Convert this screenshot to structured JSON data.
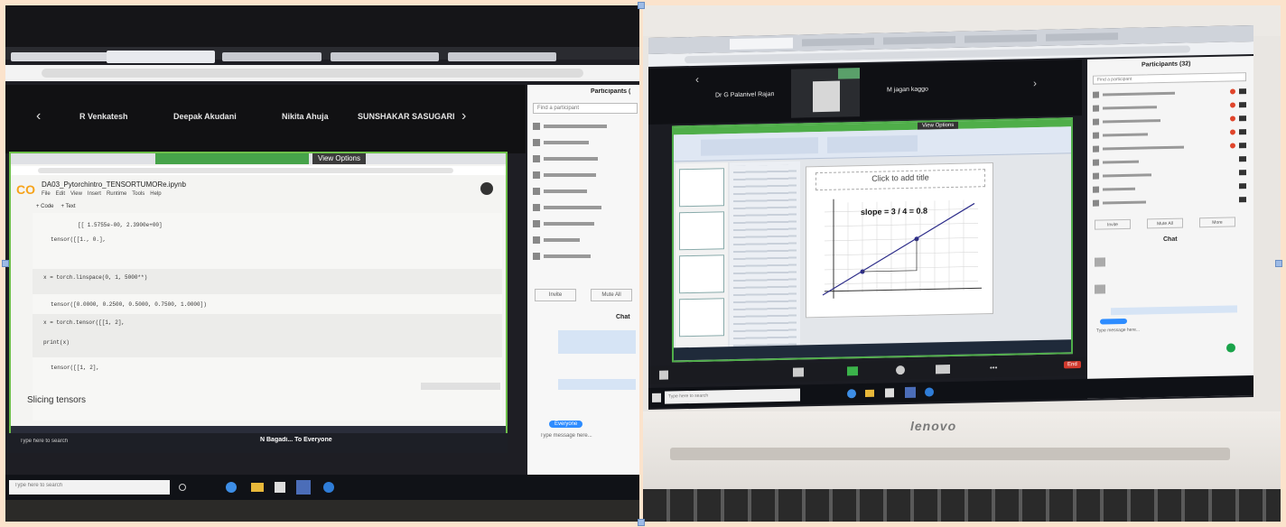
{
  "left_photo": {
    "meeting_participants": [
      "R Venkatesh",
      "Deepak Akudani",
      "Nikita Ahuja",
      "SUNSHAKAR SASUGARI"
    ],
    "participants_title": "Participants (",
    "participants_search": "Find a participant",
    "colab_file": "DA03_Pytorchintro_TENSORTUMORe.ipynb",
    "colab_menu": [
      "File",
      "Edit",
      "View",
      "Insert",
      "Runtime",
      "Tools",
      "Help"
    ],
    "colab_actions": [
      "+ Code",
      "+ Text"
    ],
    "sharing_bar": "View Options",
    "code_cells": [
      "[[ 1.5755e-00,  2.3900e+00]",
      "tensor([[1., 0.],",
      "x = torch.linspace(0, 1, 5000**)",
      "tensor([0.0000, 0.2500, 0.5000, 0.7500, 1.0000])",
      "x = torch.tensor([[1, 2],",
      "print(x)",
      "tensor([[1, 2],"
    ],
    "section_heading": "Slicing tensors",
    "chat_title": "Chat",
    "chat_bottom": "N Bagadi... To Everyone",
    "chat_input_hint": "Type message here...",
    "chat_to": "Everyone",
    "taskbar_search": "Type here to search",
    "buttons": [
      "Invite",
      "Mute All"
    ]
  },
  "right_photo": {
    "participants_title": "Participants (32)",
    "participants_search": "Find a participant",
    "speaker_left": "Dr G Palanivel Rajan",
    "speaker_right": "M jagan kaggo",
    "slide_title": "Click to add title",
    "slide_equation": "slope = 3 / 4 = 0.8",
    "sharing_bar": "View Options",
    "chat_title": "Chat",
    "chat_input_hint": "Type message here...",
    "buttons": [
      "Invite",
      "Mute All",
      "More"
    ],
    "laptop_brand": "lenovo",
    "taskbar_search": "Type here to search",
    "end_button": "End",
    "slide_thumbs": 4
  }
}
